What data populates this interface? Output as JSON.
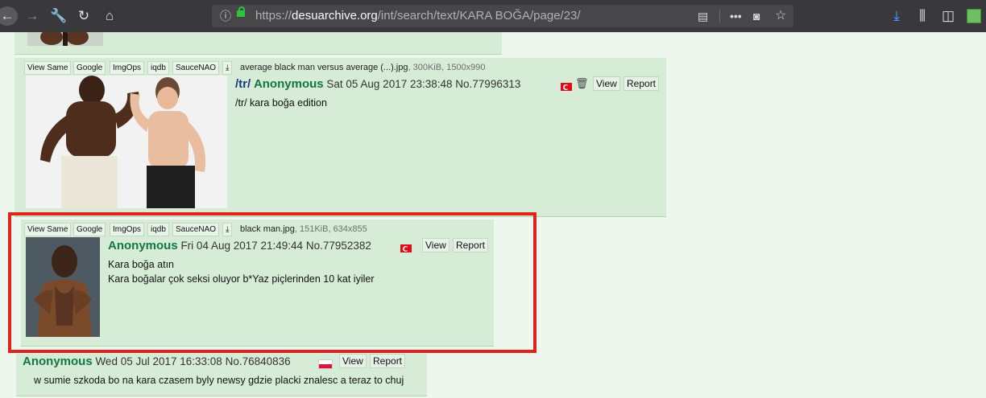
{
  "browser": {
    "url_prefix": "https://",
    "url_domain": "desuarchive.org",
    "url_path": "/int/search/text/KARA BOĞA/page/23/",
    "icons": [
      "back-icon",
      "forward-icon",
      "wrench-icon",
      "reload-icon",
      "home-icon",
      "info-icon",
      "lock-icon",
      "reader-view-icon",
      "more-icon",
      "pocket-icon",
      "bookmark-star-icon",
      "download-icon",
      "library-icon",
      "sidebar-icon",
      "extension-icon"
    ]
  },
  "posts": [
    {
      "image_buttons": [
        "View Same",
        "Google",
        "ImgOps",
        "iqdb",
        "SauceNAO"
      ],
      "file_name": "average black man versus average (...).jpg",
      "file_meta": ", 300KiB, 1500x990",
      "board": "/tr/",
      "name": "Anonymous",
      "date": "Sat 05 Aug 2017 23:38:48",
      "number": "No.77996313",
      "view_label": "View",
      "report_label": "Report",
      "lines": [
        "/tr/ kara boğa edition"
      ]
    },
    {
      "image_buttons": [
        "View Same",
        "Google",
        "ImgOps",
        "iqdb",
        "SauceNAO"
      ],
      "file_name": "black man.jpg",
      "file_meta": ", 151KiB, 634x855",
      "name": "Anonymous",
      "date": "Fri 04 Aug 2017 21:49:44",
      "number": "No.77952382",
      "view_label": "View",
      "report_label": "Report",
      "lines": [
        "Kara boğa atın",
        "Kara boğalar çok seksi oluyor b*Yaz piçlerinden 10 kat iyiler"
      ]
    },
    {
      "name": "Anonymous",
      "date": "Wed 05 Jul 2017 16:33:08",
      "number": "No.76840836",
      "view_label": "View",
      "report_label": "Report",
      "lines": [
        "w sumie szkoda bo na kara czasem byly newsy gdzie placki znalesc a teraz to chuj"
      ]
    }
  ],
  "colors": {
    "highlight": "#e0221a",
    "name": "#117743",
    "board": "#1a3a80",
    "post_bg": "#d6ecd6"
  }
}
